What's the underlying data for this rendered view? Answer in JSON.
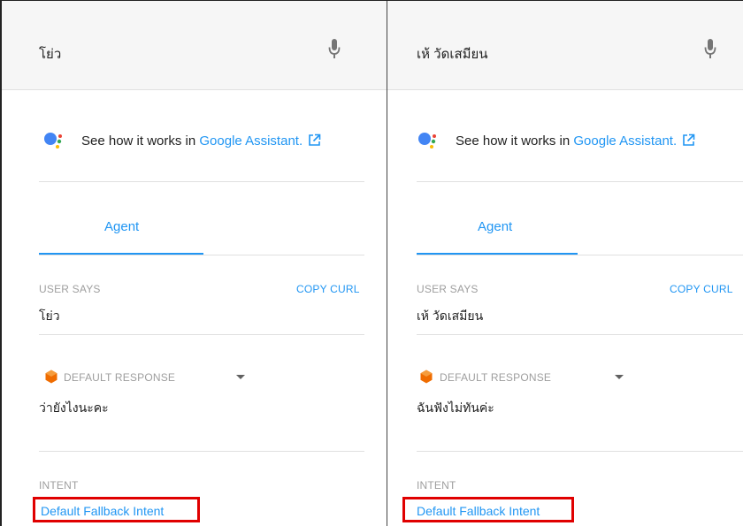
{
  "panels": [
    {
      "query": "โย่ว",
      "assistant": {
        "prefix": "See how it works in ",
        "link": "Google Assistant."
      },
      "tab": "Agent",
      "user_says_label": "USER SAYS",
      "copy_curl": "COPY CURL",
      "user_says_text": "โย่ว",
      "response_label": "DEFAULT RESPONSE",
      "response_text": "ว่ายังไงนะคะ",
      "intent_label": "INTENT",
      "intent_name": "Default Fallback Intent"
    },
    {
      "query": "เห้ วัดเสมียน",
      "assistant": {
        "prefix": "See how it works in ",
        "link": "Google Assistant."
      },
      "tab": "Agent",
      "user_says_label": "USER SAYS",
      "copy_curl": "COPY CURL",
      "user_says_text": "เห้ วัดเสมียน",
      "response_label": "DEFAULT RESPONSE",
      "response_text": "ฉันฟังไม่ทันค่ะ",
      "intent_label": "INTENT",
      "intent_name": "Default Fallback Intent"
    }
  ],
  "icons": {
    "mic": "microphone-icon",
    "assistant": "google-assistant-icon",
    "external": "external-link-icon",
    "response": "dialogflow-response-icon",
    "dropdown": "chevron-down-icon"
  },
  "colors": {
    "accent": "#2196f3",
    "highlight": "#e00000",
    "response_icon": "#ef6c00"
  }
}
